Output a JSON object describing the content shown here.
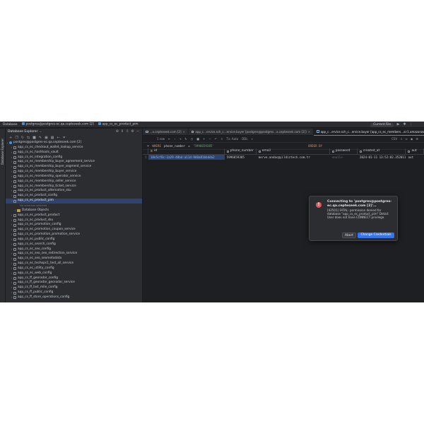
{
  "topbar": {
    "breadcrumb": [
      "Database",
      "postgres@postgres-ec.qa.cepteseek.com [2]",
      "app_cs_ec_product_pim"
    ],
    "current_file": "Current File"
  },
  "explorer": {
    "title": "Database Explorer",
    "root": "postgres@postgres-ec.qa.cepteseek.com [2]",
    "items_before": [
      "app_cs_ec_checkout_wallet_lookup_service",
      "app_cs_ec_hashtools_vault",
      "app_cs_ec_integration_config",
      "app_cs_ec_membership_buyer_agreement_service",
      "app_cs_ec_membership_buyer_segment_service",
      "app_cs_ec_membership_buyer_service",
      "app_cs_ec_membership_operator_service",
      "app_cs_ec_membership_seller_service",
      "app_cs_ec_membership_ticket_service",
      "app_cs_ec_product_alternative_sku",
      "app_cs_ec_product_config"
    ],
    "selected": "app_cs_ec_product_pim",
    "selected_note": "No schemas selected",
    "db_objects": "Database Objects",
    "items_after": [
      "app_cs_ec_product_product",
      "app_cs_ec_product_sku",
      "app_cs_ec_promotion_config",
      "app_cs_ec_promotion_coupon_service",
      "app_cs_ec_promotion_promotion_service",
      "app_cs_ec_public_config",
      "app_cs_ec_search_config",
      "app_cs_ec_seo_config",
      "app_cs_ec_seo_seo_redirection_service",
      "app_cs_ec_seo_seometadata",
      "app_cs_ec_techops1_test_all_service",
      "app_cs_ec_utility_config",
      "app_cs_ec_web_config",
      "app_cs_ff_georadar_config",
      "app_cs_ff_georadar_georadar_service",
      "app_cs_ff_last_mile_config",
      "app_cs_ff_public_config",
      "app_cs_ff_store_operations_config"
    ]
  },
  "editor": {
    "tabs": [
      {
        "label": "…a.cepteseek.com [2]"
      },
      {
        "label": "app_c…ervice.sch_c…ervice.buyer [postgres@postgres…a.cepteseek.com [2]]"
      },
      {
        "label": "app_c…ervice.sch_c…ervice.buyer [app_cs_ec_members…ai-1.amazonaws.com]",
        "active": true
      }
    ],
    "toolbar": {
      "rows": "1 row",
      "tx": "Tx: Auto",
      "ddl": "DDL",
      "csv": "CSV"
    },
    "filter": {
      "where_kw": "WHERE",
      "column": "phone_number",
      "operator": "=",
      "value": "'5996659385'",
      "order_kw": "ORDER BY"
    },
    "columns": [
      "id",
      "phone_number",
      "email",
      "password",
      "created_at",
      "aut"
    ],
    "rows": [
      {
        "num": "1",
        "id": "18e5cf8c-1a29-48bd-a11d-9d0a81bbdda2",
        "phone_number": "5996659385",
        "email": "merve.andac@yildiztech.com.tr",
        "password": "<null>",
        "created_at": "2024-01-11 13:52:02.352011",
        "aut": "aut"
      }
    ]
  },
  "dialog": {
    "title": "Connecting to 'postgres@postgres-ec.qa.cepteseek.com [2]'…",
    "message": "[42501] FATAL: permission denied for database \"app_cs_ec_product_pim\" Detail: User does not have CONNECT privilege.",
    "abort_label": "Abort",
    "change_label": "Change Credentials"
  },
  "colors": {
    "accent": "#3574f0",
    "error": "#db5c5c",
    "selection": "#2e436e"
  }
}
